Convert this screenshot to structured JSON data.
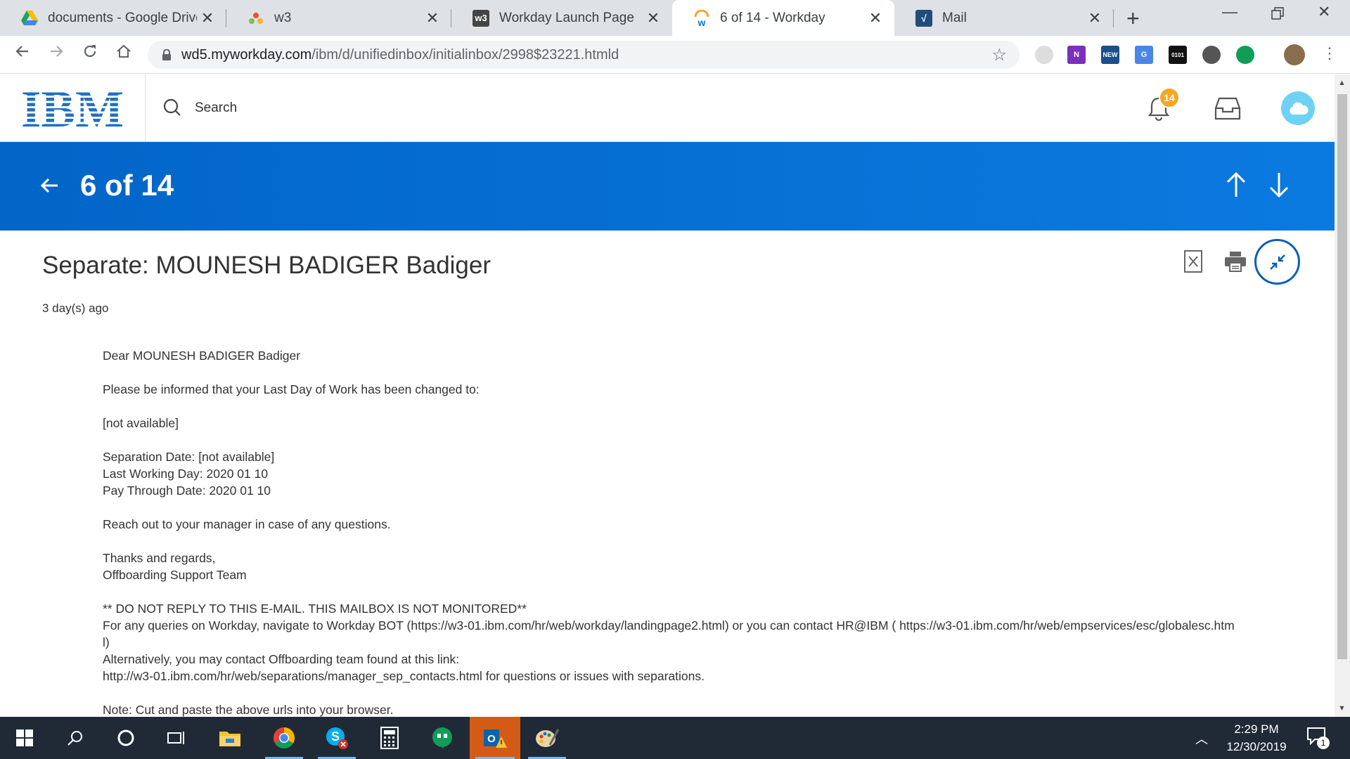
{
  "browser": {
    "tabs": [
      {
        "title": "documents - Google Drive",
        "close": "✕"
      },
      {
        "title": "w3",
        "close": "✕"
      },
      {
        "title": "Workday Launch Page",
        "close": "✕"
      },
      {
        "title": "6 of 14 - Workday",
        "close": "✕"
      },
      {
        "title": "Mail",
        "close": "✕"
      }
    ],
    "url_host": "wd5.myworkday.com",
    "url_path": "/ibm/d/unifiedinbox/initialinbox/2998$23221.htmld"
  },
  "header": {
    "logo_text": "IBM",
    "search_placeholder": "Search",
    "notification_count": "14"
  },
  "banner": {
    "counter": "6 of 14"
  },
  "message": {
    "title": "Separate: MOUNESH BADIGER Badiger",
    "time": "3 day(s) ago",
    "body": [
      "Dear MOUNESH BADIGER Badiger",
      "",
      "Please be informed that your Last Day of Work has been changed to:",
      "",
      "[not available]",
      "",
      "Separation Date: [not available]",
      "Last Working Day: 2020 01 10",
      "Pay Through Date: 2020 01 10",
      "",
      "Reach out to your manager in case of any questions.",
      "",
      "Thanks and regards,",
      "Offboarding Support Team",
      "",
      "** DO NOT REPLY TO THIS E-MAIL. THIS MAILBOX IS NOT MONITORED**",
      "For any queries on Workday, navigate to Workday BOT (https://w3-01.ibm.com/hr/web/workday/landingpage2.html) or you can contact HR@IBM ( https://w3-01.ibm.com/hr/web/empservices/esc/globalesc.htm",
      "l)",
      "Alternatively, you may contact Offboarding team found at this link:",
      "http://w3-01.ibm.com/hr/web/separations/manager_sep_contacts.html for questions or issues with separations.",
      "",
      "Note: Cut and paste the above urls into your browser."
    ]
  },
  "taskbar": {
    "time": "2:29 PM",
    "date": "12/30/2019",
    "notification_count": "1"
  }
}
